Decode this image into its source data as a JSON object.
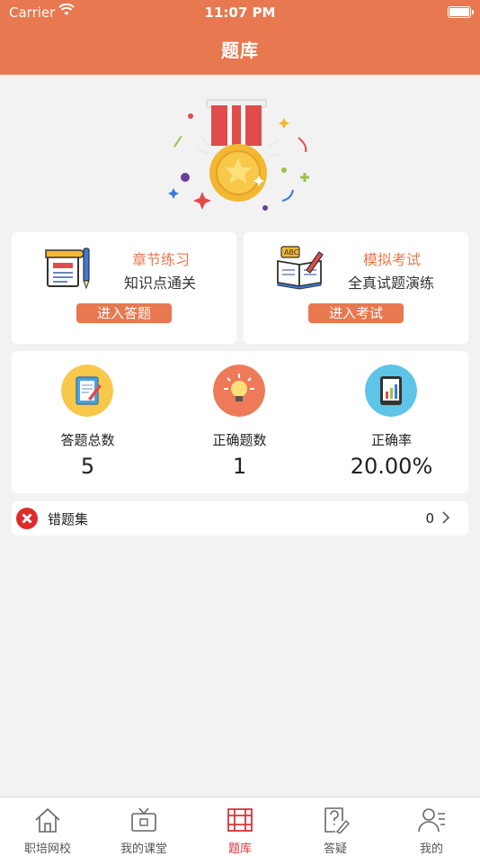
{
  "status_bar": {
    "carrier": "Carrier",
    "time": "11:07 PM"
  },
  "header": {
    "title": "题库"
  },
  "colors": {
    "accent": "#e8784f",
    "active_tab": "#d8343a"
  },
  "practice_cards": [
    {
      "icon": "notebook-pen-icon",
      "title": "章节练习",
      "subtitle": "知识点通关",
      "button": "进入答题"
    },
    {
      "icon": "abc-book-icon",
      "title": "模拟考试",
      "subtitle": "全真试题演练",
      "button": "进入考试"
    }
  ],
  "stats": [
    {
      "icon": "notebook-icon",
      "label": "答题总数",
      "value": "5"
    },
    {
      "icon": "lightbulb-icon",
      "label": "正确题数",
      "value": "1"
    },
    {
      "icon": "tablet-chart-icon",
      "label": "正确率",
      "value": "20.00%"
    }
  ],
  "wrong_set": {
    "label": "错题集",
    "count": "0"
  },
  "tabs": [
    {
      "label": "职培网校",
      "icon": "home-icon",
      "active": false
    },
    {
      "label": "我的课堂",
      "icon": "tv-icon",
      "active": false
    },
    {
      "label": "题库",
      "icon": "question-bank-icon",
      "active": true
    },
    {
      "label": "答疑",
      "icon": "question-doc-icon",
      "active": false
    },
    {
      "label": "我的",
      "icon": "profile-icon",
      "active": false
    }
  ]
}
